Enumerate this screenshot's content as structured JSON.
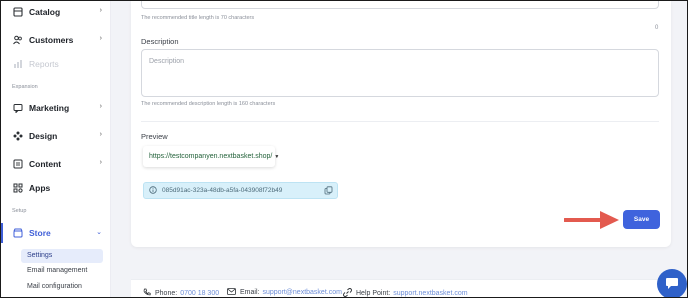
{
  "sidebar": {
    "items": [
      {
        "label": "Catalog",
        "icon": "catalog-icon"
      },
      {
        "label": "Customers",
        "icon": "customers-icon"
      },
      {
        "label": "Reports",
        "icon": "reports-icon"
      },
      {
        "label": "Marketing",
        "icon": "marketing-icon"
      },
      {
        "label": "Design",
        "icon": "design-icon"
      },
      {
        "label": "Content",
        "icon": "content-icon"
      },
      {
        "label": "Apps",
        "icon": "apps-icon"
      },
      {
        "label": "Store",
        "icon": "store-icon"
      }
    ],
    "section_expansion": "Expansion",
    "section_setup": "Setup",
    "store_subitems": [
      "Settings",
      "Email management",
      "Mail configuration"
    ]
  },
  "form": {
    "title_hint": "The recommended title length is 70 characters",
    "title_counter": "0",
    "description_label": "Description",
    "description_placeholder": "Description",
    "description_hint": "The recommended description length is 160 characters",
    "preview_label": "Preview",
    "preview_url": "https://testcompanyen.nextbasket.shop/",
    "id_value": "085d91ac-323a-48db-a5fa-043908f72b49",
    "save_label": "Save"
  },
  "footer": {
    "phone_label": "Phone:",
    "phone_value": "0700 18 300",
    "email_label": "Email:",
    "email_value": "support@nextbasket.com",
    "help_label": "Help Point:",
    "help_value": "support.nextbasket.com"
  },
  "colors": {
    "accent": "#3f63dd",
    "arrow": "#e35a4f",
    "chip_bg": "#d8f0fa",
    "chat": "#2f61c9"
  }
}
